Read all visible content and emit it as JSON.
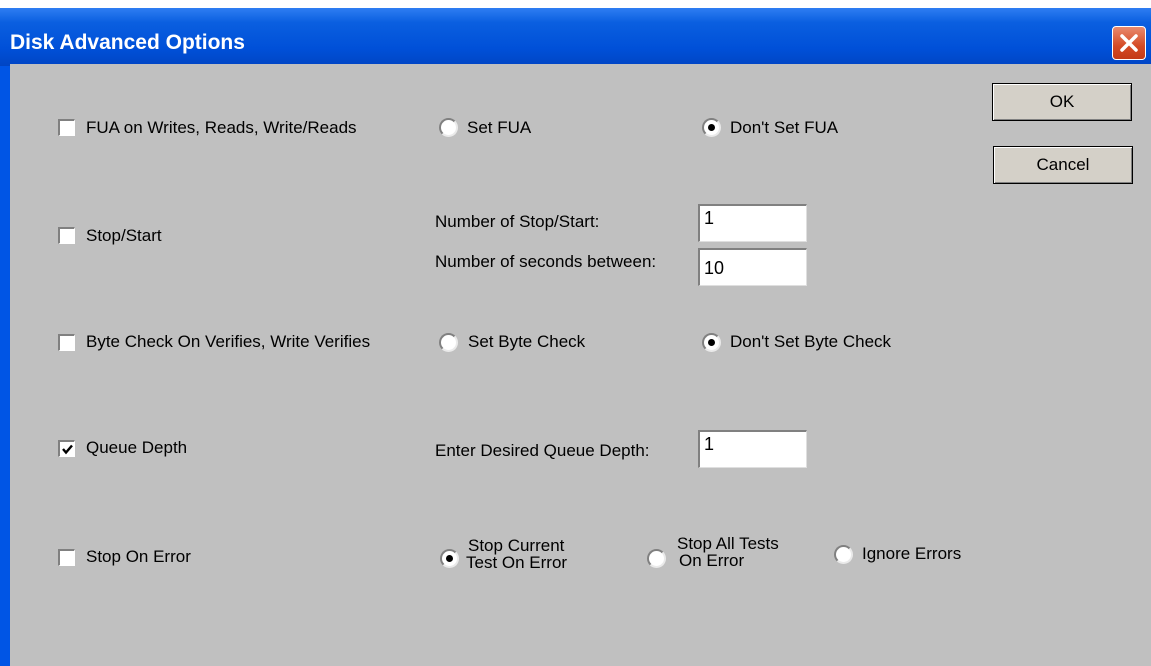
{
  "window": {
    "title": "Disk Advanced Options"
  },
  "buttons": {
    "ok": "OK",
    "cancel": "Cancel"
  },
  "fua": {
    "label": "FUA on Writes, Reads, Write/Reads",
    "checked": false,
    "opt_set": "Set FUA",
    "opt_dont": "Don't Set FUA",
    "selected": "Don't Set FUA"
  },
  "stopstart": {
    "label": "Stop/Start",
    "checked": false,
    "count_label": "Number of Stop/Start:",
    "count_value": "1",
    "seconds_label": "Number of seconds between:",
    "seconds_value": "10"
  },
  "bytecheck": {
    "label": "Byte Check On Verifies, Write Verifies",
    "checked": false,
    "opt_set": "Set  Byte Check",
    "opt_dont": "Don't Set Byte Check",
    "selected": "Don't Set Byte Check"
  },
  "queue": {
    "label": "Queue Depth",
    "checked": true,
    "depth_label": "Enter Desired Queue Depth:",
    "depth_value": "1"
  },
  "stoponerror": {
    "label": "Stop On Error",
    "checked": false,
    "opt_current_line1": "Stop Current",
    "opt_current_line2": "Test On Error",
    "opt_all_line1": "Stop All Tests",
    "opt_all_line2": "On Error",
    "opt_ignore": "Ignore Errors",
    "selected": "Stop Current Test On Error"
  }
}
